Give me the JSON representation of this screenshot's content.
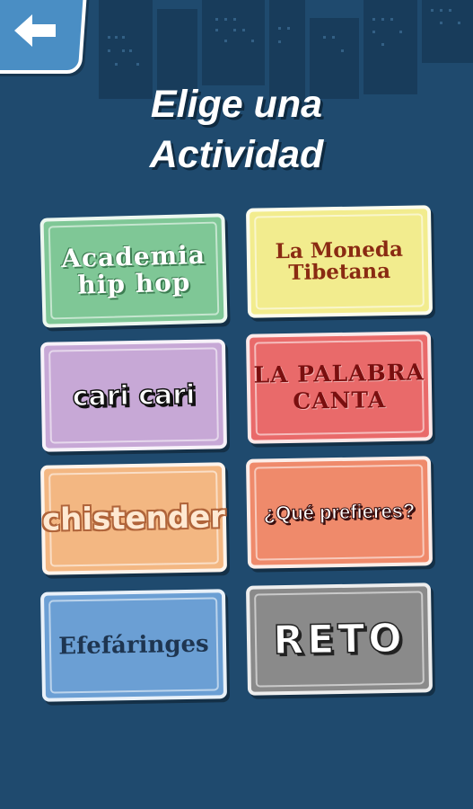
{
  "header": {
    "back_icon": "back-arrow-icon",
    "title_line1": "Elige una",
    "title_line2": "Actividad"
  },
  "activities": [
    {
      "line1": "Academia",
      "line2": "hip hop",
      "color": "#7fc796"
    },
    {
      "line1": "La Moneda",
      "line2": "Tibetana",
      "color": "#f2ec8e"
    },
    {
      "label": "cari cari",
      "color": "#c7a8d6"
    },
    {
      "line1": "LA PALABRA",
      "line2": "CANTA",
      "color": "#e96a6a"
    },
    {
      "label": "chistender",
      "color": "#f3b782"
    },
    {
      "label": "¿Qué prefieres?",
      "color": "#ef8a6b"
    },
    {
      "label": "Efefáringes",
      "color": "#6b9fd4"
    },
    {
      "label": "RETO",
      "color": "#8a8a8a"
    }
  ],
  "colors": {
    "background": "#1f4a6e",
    "skyline": "#173a58",
    "back_button": "#4a8ec4"
  }
}
